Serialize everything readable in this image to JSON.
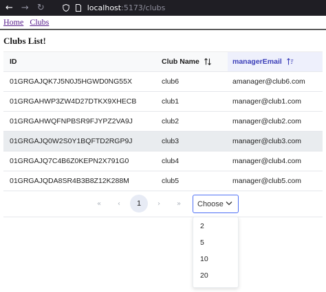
{
  "browser": {
    "back_icon": "←",
    "forward_icon": "→",
    "reload_icon": "↻",
    "url_host": "localhost",
    "url_path": ":5173/clubs"
  },
  "nav": {
    "home": "Home",
    "clubs": "Clubs"
  },
  "page_title": "Clubs List!",
  "table": {
    "headers": {
      "id": "ID",
      "club_name": "Club Name",
      "manager_email": "managerEmail"
    },
    "rows": [
      {
        "id": "01GRGAJQK7J5N0J5HGWD0NG55X",
        "club_name": "club6",
        "manager_email": "amanager@club6.com"
      },
      {
        "id": "01GRGAHWP3ZW4D27DTKX9XHECB",
        "club_name": "club1",
        "manager_email": "manager@club1.com"
      },
      {
        "id": "01GRGAHWQFNPBSR9FJYPZ2VA9J",
        "club_name": "club2",
        "manager_email": "manager@club2.com"
      },
      {
        "id": "01GRGAJQ0W2S0Y1BQFTD2RGP9J",
        "club_name": "club3",
        "manager_email": "manager@club3.com"
      },
      {
        "id": "01GRGAJQ7C4B6Z0KEPN2X791G0",
        "club_name": "club4",
        "manager_email": "manager@club4.com"
      },
      {
        "id": "01GRGAJQDA8SR4B3B8Z12K288M",
        "club_name": "club5",
        "manager_email": "manager@club5.com"
      }
    ]
  },
  "pagination": {
    "first": "«",
    "prev": "‹",
    "current_page": "1",
    "next": "›",
    "last": "»",
    "page_size_placeholder": "Choose",
    "options": [
      "2",
      "5",
      "10",
      "20"
    ]
  },
  "colors": {
    "accent": "#4c6ef5",
    "active_header_text": "#3b3eb8",
    "hover_row": "#e9ecef"
  }
}
